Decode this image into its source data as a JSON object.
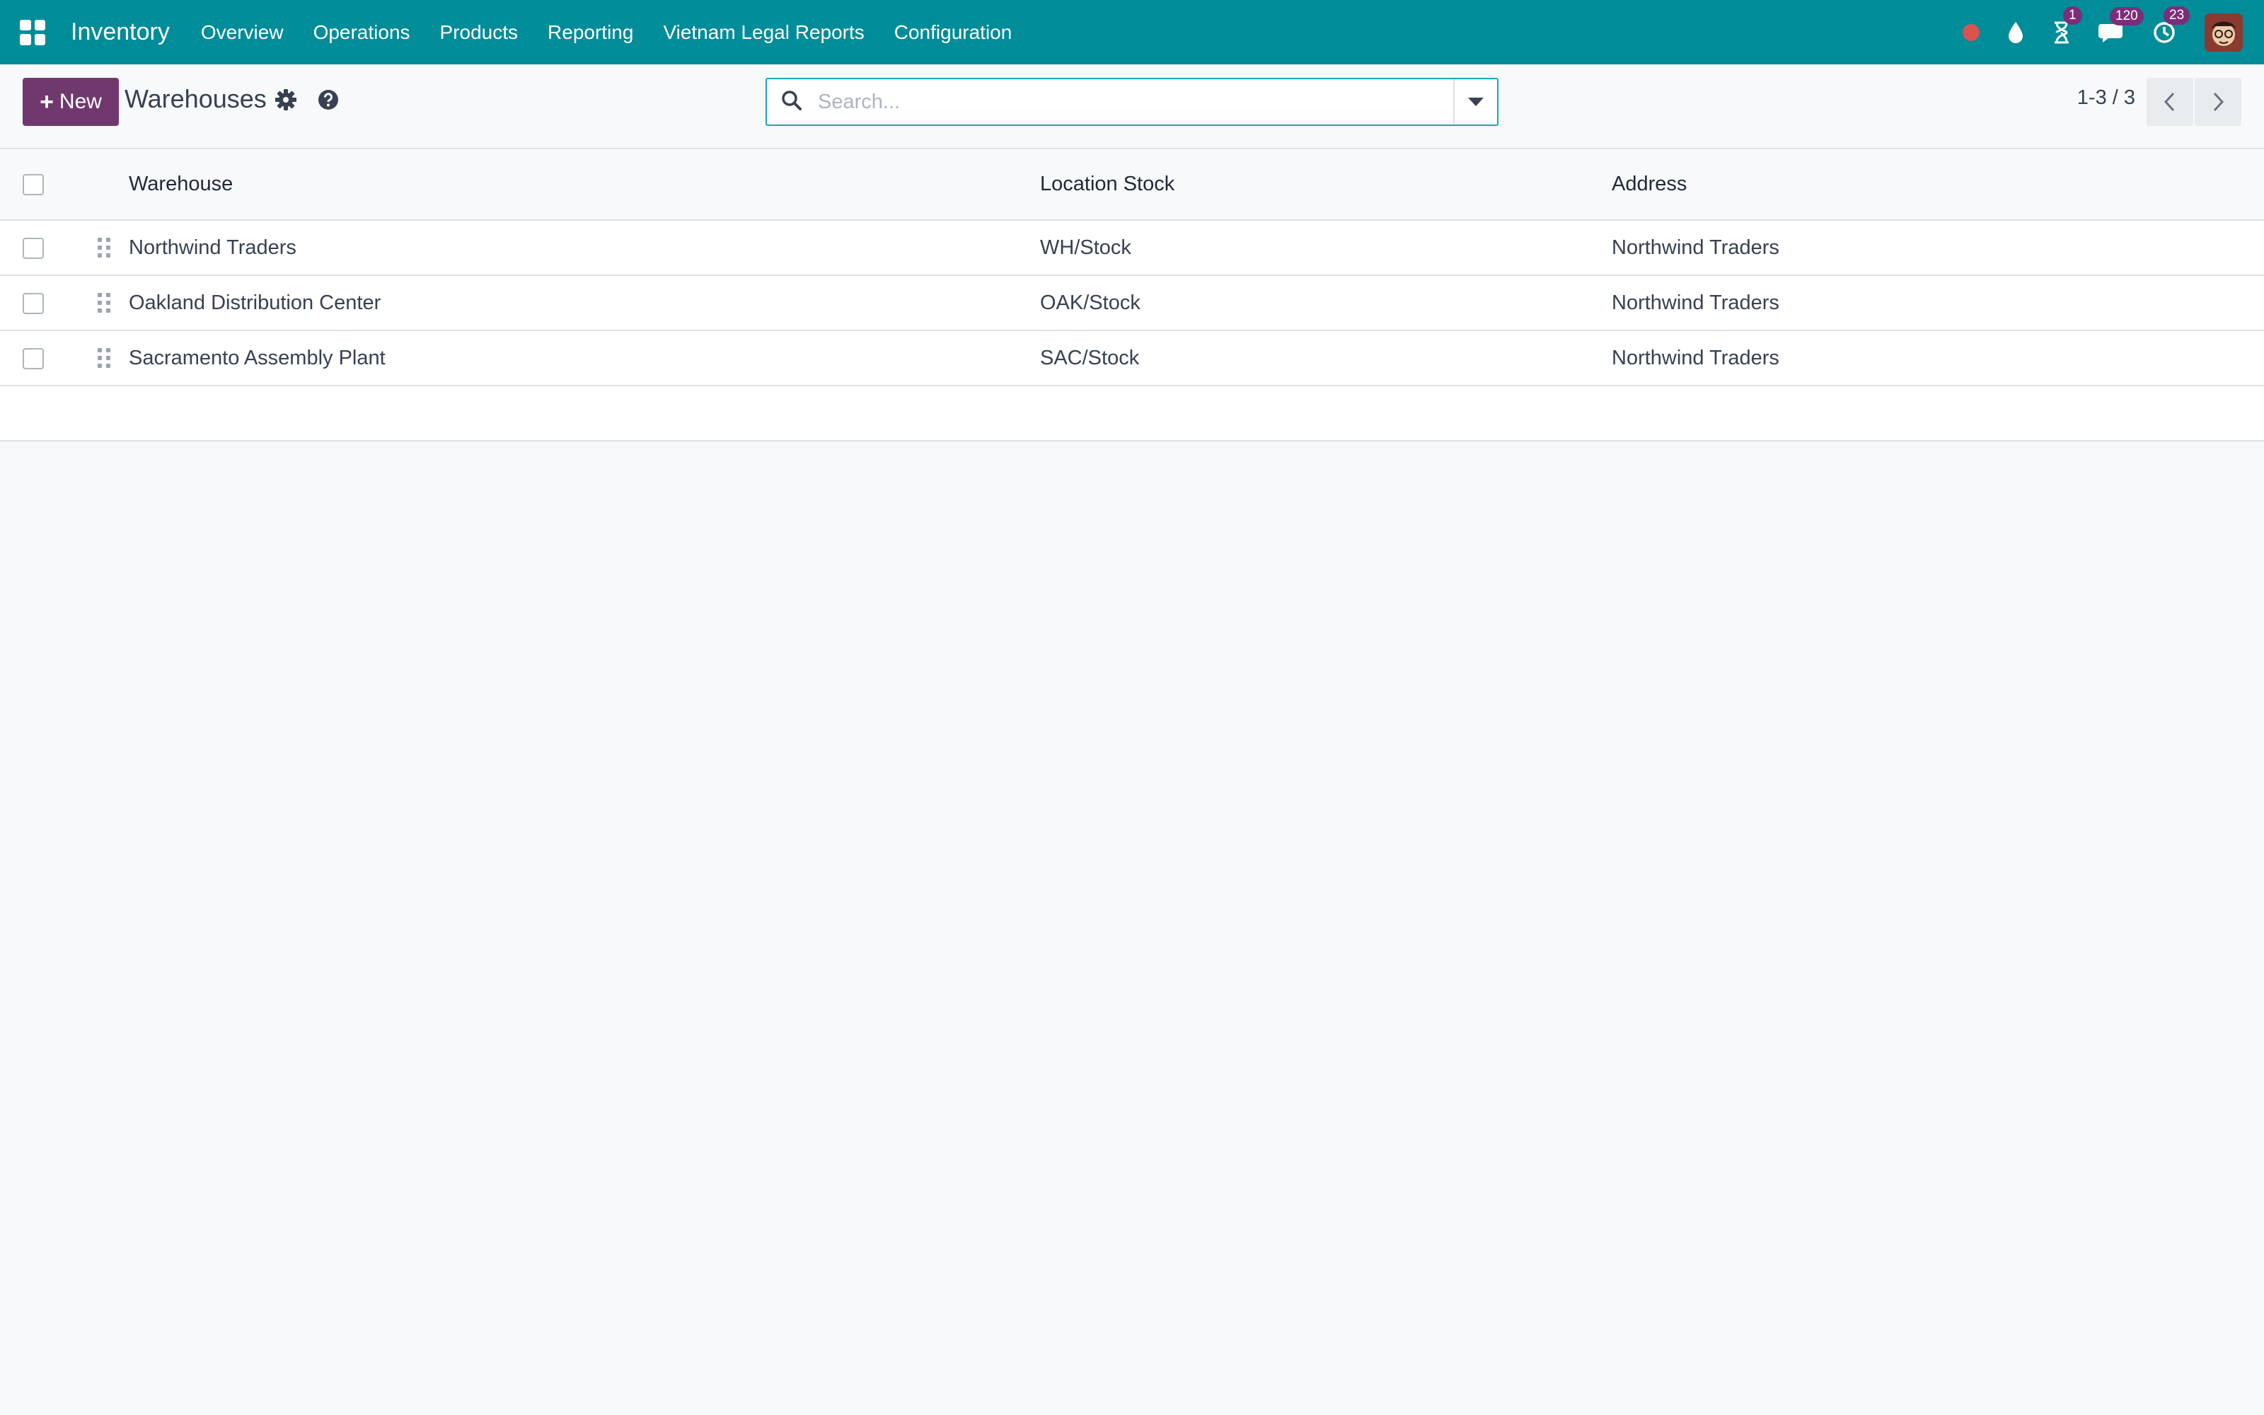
{
  "navbar": {
    "app_title": "Inventory",
    "menu": [
      "Overview",
      "Operations",
      "Products",
      "Reporting",
      "Vietnam Legal Reports",
      "Configuration"
    ],
    "badges": {
      "activities": "1",
      "messages": "120",
      "timer": "23"
    },
    "icons": [
      "apps-grid-icon",
      "recording-dot-icon",
      "drop-icon",
      "hourglass-icon",
      "chat-icon",
      "clock-icon",
      "user-avatar"
    ],
    "colors": {
      "navbar": "#008c99",
      "badge": "#7c2d7a",
      "primary": "#71386e"
    }
  },
  "control_panel": {
    "new_label": "New",
    "title": "Warehouses",
    "search_placeholder": "Search...",
    "pager": "1-3 / 3"
  },
  "table": {
    "columns": [
      "Warehouse",
      "Location Stock",
      "Address"
    ],
    "rows": [
      {
        "warehouse": "Northwind Traders",
        "location": "WH/Stock",
        "address": "Northwind Traders"
      },
      {
        "warehouse": "Oakland Distribution Center",
        "location": "OAK/Stock",
        "address": "Northwind Traders"
      },
      {
        "warehouse": "Sacramento Assembly Plant",
        "location": "SAC/Stock",
        "address": "Northwind Traders"
      }
    ]
  }
}
